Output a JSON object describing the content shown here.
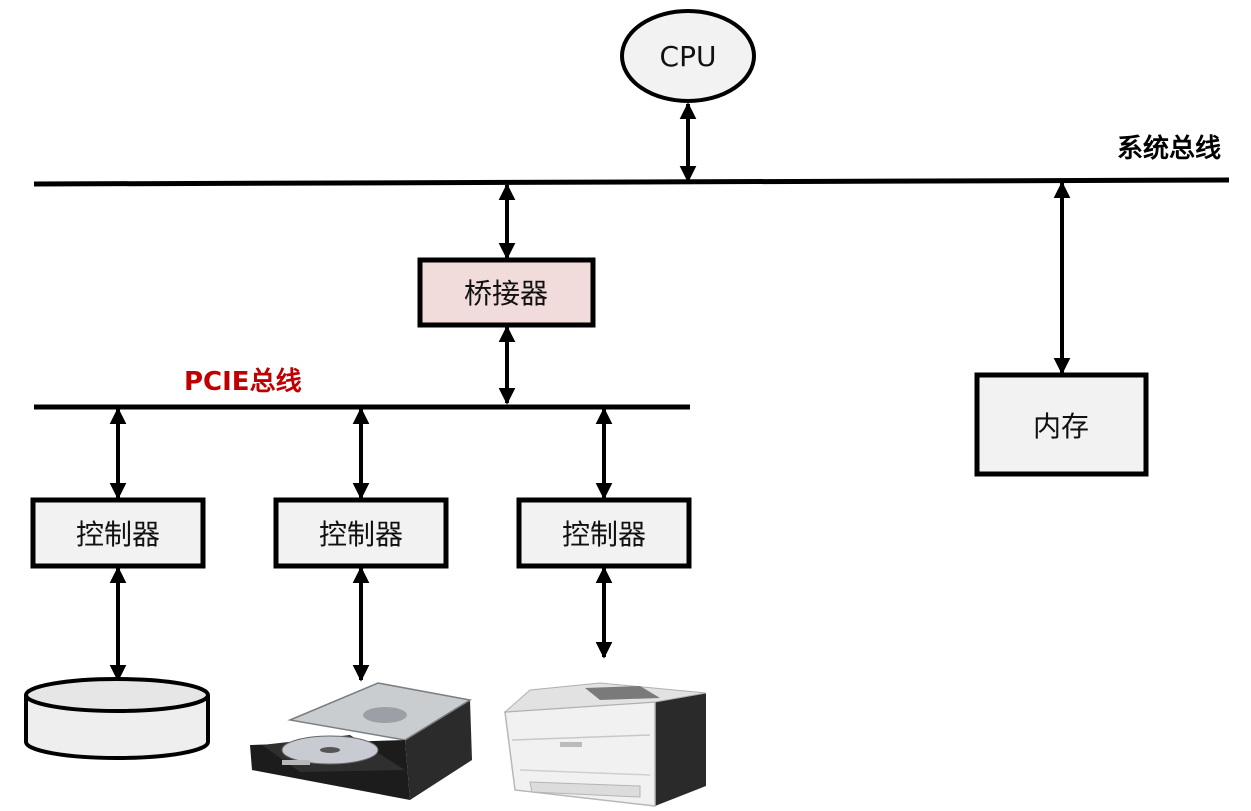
{
  "cpu": {
    "label": "CPU"
  },
  "system_bus": {
    "label": "系统总线",
    "color": "#000000"
  },
  "pcie_bus": {
    "label": "PCIE总线",
    "color": "#c00000"
  },
  "bridge": {
    "label": "桥接器",
    "fill": "#f2dcdb"
  },
  "memory": {
    "label": "内存"
  },
  "controllers": [
    {
      "label": "控制器"
    },
    {
      "label": "控制器"
    },
    {
      "label": "控制器"
    }
  ],
  "devices": [
    {
      "icon": "disk-icon"
    },
    {
      "icon": "optical-drive-icon"
    },
    {
      "icon": "printer-icon"
    }
  ]
}
